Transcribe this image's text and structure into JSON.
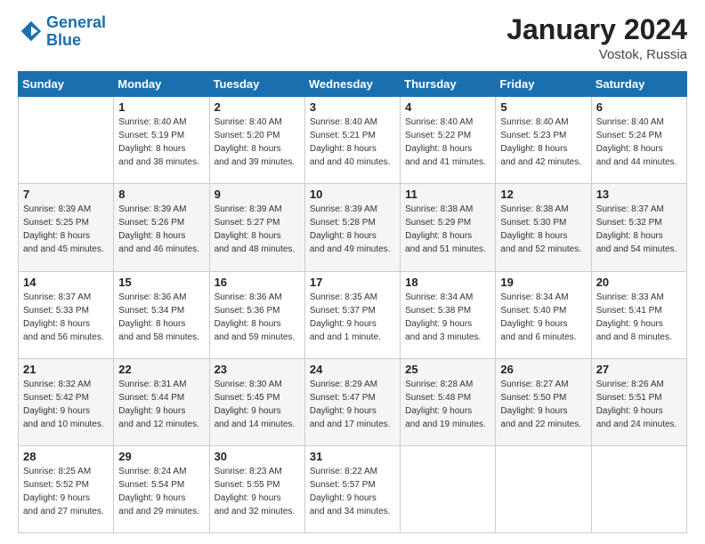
{
  "header": {
    "logo_line1": "General",
    "logo_line2": "Blue",
    "month": "January 2024",
    "location": "Vostok, Russia"
  },
  "days_of_week": [
    "Sunday",
    "Monday",
    "Tuesday",
    "Wednesday",
    "Thursday",
    "Friday",
    "Saturday"
  ],
  "weeks": [
    [
      {
        "day": "",
        "sunrise": "",
        "sunset": "",
        "daylight": ""
      },
      {
        "day": "1",
        "sunrise": "Sunrise: 8:40 AM",
        "sunset": "Sunset: 5:19 PM",
        "daylight": "Daylight: 8 hours and 38 minutes."
      },
      {
        "day": "2",
        "sunrise": "Sunrise: 8:40 AM",
        "sunset": "Sunset: 5:20 PM",
        "daylight": "Daylight: 8 hours and 39 minutes."
      },
      {
        "day": "3",
        "sunrise": "Sunrise: 8:40 AM",
        "sunset": "Sunset: 5:21 PM",
        "daylight": "Daylight: 8 hours and 40 minutes."
      },
      {
        "day": "4",
        "sunrise": "Sunrise: 8:40 AM",
        "sunset": "Sunset: 5:22 PM",
        "daylight": "Daylight: 8 hours and 41 minutes."
      },
      {
        "day": "5",
        "sunrise": "Sunrise: 8:40 AM",
        "sunset": "Sunset: 5:23 PM",
        "daylight": "Daylight: 8 hours and 42 minutes."
      },
      {
        "day": "6",
        "sunrise": "Sunrise: 8:40 AM",
        "sunset": "Sunset: 5:24 PM",
        "daylight": "Daylight: 8 hours and 44 minutes."
      }
    ],
    [
      {
        "day": "7",
        "sunrise": "Sunrise: 8:39 AM",
        "sunset": "Sunset: 5:25 PM",
        "daylight": "Daylight: 8 hours and 45 minutes."
      },
      {
        "day": "8",
        "sunrise": "Sunrise: 8:39 AM",
        "sunset": "Sunset: 5:26 PM",
        "daylight": "Daylight: 8 hours and 46 minutes."
      },
      {
        "day": "9",
        "sunrise": "Sunrise: 8:39 AM",
        "sunset": "Sunset: 5:27 PM",
        "daylight": "Daylight: 8 hours and 48 minutes."
      },
      {
        "day": "10",
        "sunrise": "Sunrise: 8:39 AM",
        "sunset": "Sunset: 5:28 PM",
        "daylight": "Daylight: 8 hours and 49 minutes."
      },
      {
        "day": "11",
        "sunrise": "Sunrise: 8:38 AM",
        "sunset": "Sunset: 5:29 PM",
        "daylight": "Daylight: 8 hours and 51 minutes."
      },
      {
        "day": "12",
        "sunrise": "Sunrise: 8:38 AM",
        "sunset": "Sunset: 5:30 PM",
        "daylight": "Daylight: 8 hours and 52 minutes."
      },
      {
        "day": "13",
        "sunrise": "Sunrise: 8:37 AM",
        "sunset": "Sunset: 5:32 PM",
        "daylight": "Daylight: 8 hours and 54 minutes."
      }
    ],
    [
      {
        "day": "14",
        "sunrise": "Sunrise: 8:37 AM",
        "sunset": "Sunset: 5:33 PM",
        "daylight": "Daylight: 8 hours and 56 minutes."
      },
      {
        "day": "15",
        "sunrise": "Sunrise: 8:36 AM",
        "sunset": "Sunset: 5:34 PM",
        "daylight": "Daylight: 8 hours and 58 minutes."
      },
      {
        "day": "16",
        "sunrise": "Sunrise: 8:36 AM",
        "sunset": "Sunset: 5:36 PM",
        "daylight": "Daylight: 8 hours and 59 minutes."
      },
      {
        "day": "17",
        "sunrise": "Sunrise: 8:35 AM",
        "sunset": "Sunset: 5:37 PM",
        "daylight": "Daylight: 9 hours and 1 minute."
      },
      {
        "day": "18",
        "sunrise": "Sunrise: 8:34 AM",
        "sunset": "Sunset: 5:38 PM",
        "daylight": "Daylight: 9 hours and 3 minutes."
      },
      {
        "day": "19",
        "sunrise": "Sunrise: 8:34 AM",
        "sunset": "Sunset: 5:40 PM",
        "daylight": "Daylight: 9 hours and 6 minutes."
      },
      {
        "day": "20",
        "sunrise": "Sunrise: 8:33 AM",
        "sunset": "Sunset: 5:41 PM",
        "daylight": "Daylight: 9 hours and 8 minutes."
      }
    ],
    [
      {
        "day": "21",
        "sunrise": "Sunrise: 8:32 AM",
        "sunset": "Sunset: 5:42 PM",
        "daylight": "Daylight: 9 hours and 10 minutes."
      },
      {
        "day": "22",
        "sunrise": "Sunrise: 8:31 AM",
        "sunset": "Sunset: 5:44 PM",
        "daylight": "Daylight: 9 hours and 12 minutes."
      },
      {
        "day": "23",
        "sunrise": "Sunrise: 8:30 AM",
        "sunset": "Sunset: 5:45 PM",
        "daylight": "Daylight: 9 hours and 14 minutes."
      },
      {
        "day": "24",
        "sunrise": "Sunrise: 8:29 AM",
        "sunset": "Sunset: 5:47 PM",
        "daylight": "Daylight: 9 hours and 17 minutes."
      },
      {
        "day": "25",
        "sunrise": "Sunrise: 8:28 AM",
        "sunset": "Sunset: 5:48 PM",
        "daylight": "Daylight: 9 hours and 19 minutes."
      },
      {
        "day": "26",
        "sunrise": "Sunrise: 8:27 AM",
        "sunset": "Sunset: 5:50 PM",
        "daylight": "Daylight: 9 hours and 22 minutes."
      },
      {
        "day": "27",
        "sunrise": "Sunrise: 8:26 AM",
        "sunset": "Sunset: 5:51 PM",
        "daylight": "Daylight: 9 hours and 24 minutes."
      }
    ],
    [
      {
        "day": "28",
        "sunrise": "Sunrise: 8:25 AM",
        "sunset": "Sunset: 5:52 PM",
        "daylight": "Daylight: 9 hours and 27 minutes."
      },
      {
        "day": "29",
        "sunrise": "Sunrise: 8:24 AM",
        "sunset": "Sunset: 5:54 PM",
        "daylight": "Daylight: 9 hours and 29 minutes."
      },
      {
        "day": "30",
        "sunrise": "Sunrise: 8:23 AM",
        "sunset": "Sunset: 5:55 PM",
        "daylight": "Daylight: 9 hours and 32 minutes."
      },
      {
        "day": "31",
        "sunrise": "Sunrise: 8:22 AM",
        "sunset": "Sunset: 5:57 PM",
        "daylight": "Daylight: 9 hours and 34 minutes."
      },
      {
        "day": "",
        "sunrise": "",
        "sunset": "",
        "daylight": ""
      },
      {
        "day": "",
        "sunrise": "",
        "sunset": "",
        "daylight": ""
      },
      {
        "day": "",
        "sunrise": "",
        "sunset": "",
        "daylight": ""
      }
    ]
  ]
}
